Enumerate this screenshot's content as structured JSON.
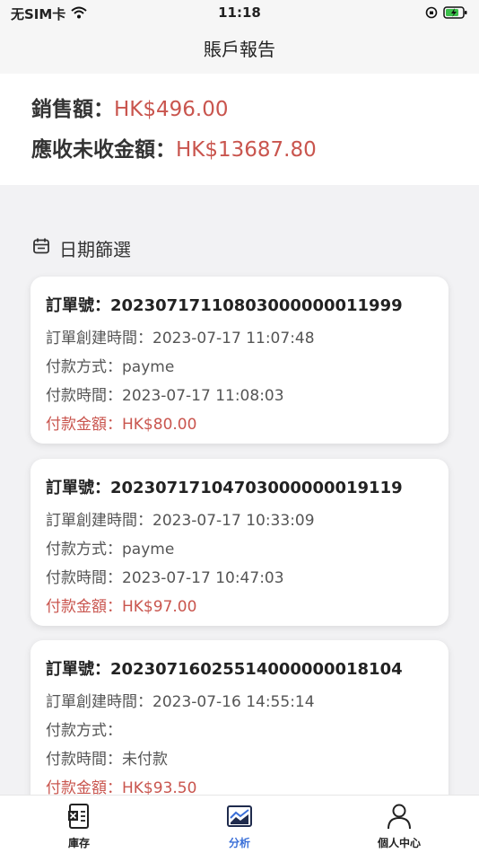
{
  "status_bar": {
    "carrier": "无SIM卡",
    "time": "11:18"
  },
  "nav": {
    "title": "賬戶報告"
  },
  "summary": {
    "sales_label": "銷售額：",
    "sales_amount": "HK$496.00",
    "receivable_label": "應收未收金額：",
    "receivable_amount": "HK$13687.80"
  },
  "filter": {
    "label": "日期篩選"
  },
  "orders": [
    {
      "order_no": "訂單號：20230717110803000000011999",
      "created": "訂單創建時間：2023-07-17 11:07:48",
      "method": "付款方式：payme",
      "paid_time": "付款時間：2023-07-17 11:08:03",
      "amount": "付款金額：HK$80.00"
    },
    {
      "order_no": "訂單號：20230717104703000000019119",
      "created": "訂單創建時間：2023-07-17 10:33:09",
      "method": "付款方式：payme",
      "paid_time": "付款時間：2023-07-17 10:47:03",
      "amount": "付款金額：HK$97.00"
    },
    {
      "order_no": "訂單號：20230716025514000000018104",
      "created": "訂單創建時間：2023-07-16 14:55:14",
      "method": "付款方式：",
      "paid_time": "付款時間：未付款",
      "amount": "付款金額：HK$93.50"
    }
  ],
  "tabs": [
    {
      "label": "庫存",
      "icon": "inventory-icon",
      "active": false
    },
    {
      "label": "分析",
      "icon": "analysis-icon",
      "active": true
    },
    {
      "label": "個人中心",
      "icon": "person-icon",
      "active": false
    }
  ],
  "colors": {
    "accent_red": "#c9554e",
    "active_tab": "#3a6fd8"
  }
}
